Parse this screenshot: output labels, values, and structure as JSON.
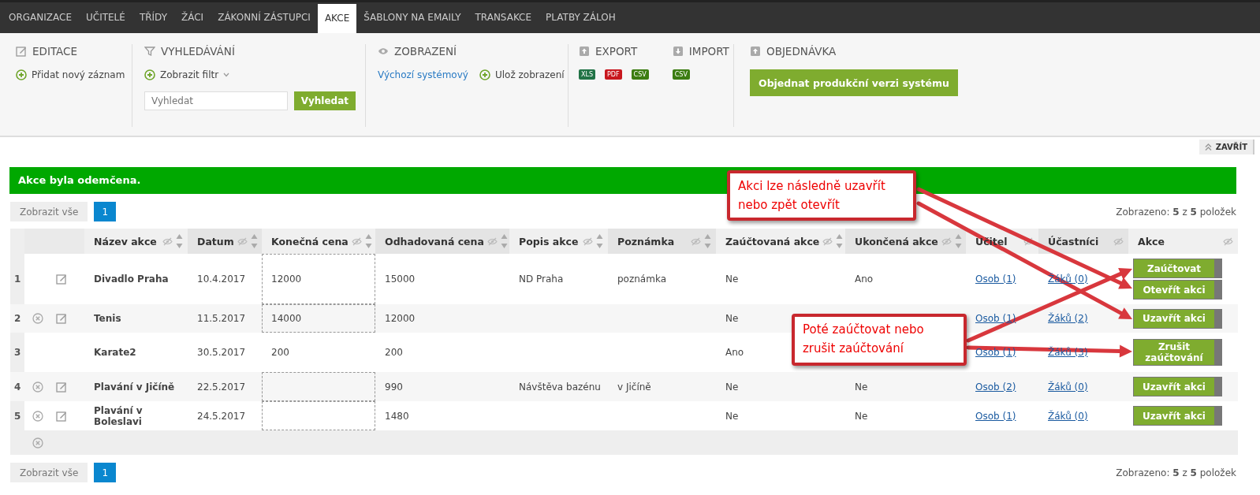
{
  "nav": {
    "tabs": [
      {
        "label": "ORGANIZACE",
        "selected": false
      },
      {
        "label": "UČITELÉ",
        "selected": false
      },
      {
        "label": "TŘÍDY",
        "selected": false
      },
      {
        "label": "ŽÁCI",
        "selected": false
      },
      {
        "label": "ZÁKONNÍ ZÁSTUPCI",
        "selected": false
      },
      {
        "label": "AKCE",
        "selected": true
      },
      {
        "label": "ŠABLONY NA EMAILY",
        "selected": false
      },
      {
        "label": "TRANSAKCE",
        "selected": false
      },
      {
        "label": "PLATBY ZÁLOH",
        "selected": false
      }
    ]
  },
  "toolbar": {
    "editing": {
      "title": "EDITACE",
      "add_label": "Přidat nový záznam"
    },
    "search": {
      "title": "VYHLEDÁVÁNÍ",
      "filter_label": "Zobrazit filtr",
      "placeholder": "Vyhledat",
      "button": "Vyhledat"
    },
    "view": {
      "title": "ZOBRAZENÍ",
      "default_link": "Výchozí systémový",
      "save_label": "Ulož zobrazení"
    },
    "export": {
      "title": "EXPORT",
      "formats": [
        {
          "label": "XLS",
          "color": "#217346"
        },
        {
          "label": "PDF",
          "color": "#c8171e"
        },
        {
          "label": "CSV",
          "color": "#3c7d12"
        }
      ]
    },
    "import": {
      "title": "IMPORT",
      "formats": [
        {
          "label": "CSV",
          "color": "#3c7d12"
        }
      ]
    },
    "order": {
      "title": "OBJEDNÁVKA",
      "button": "Objednat produkční verzi systému"
    },
    "close_label": "ZAVŘÍT"
  },
  "alert": {
    "text": "Akce byla odemčena."
  },
  "pager_top": {
    "show_all": "Zobrazit vše",
    "pages": [
      {
        "label": "1",
        "selected": true
      }
    ],
    "summary": "Zobrazeno: **5** z **5** položek"
  },
  "table": {
    "columns": [
      {
        "label": "Název akce",
        "sortable": true
      },
      {
        "label": "Datum",
        "sortable": true
      },
      {
        "label": "Konečná cena",
        "sortable": true
      },
      {
        "label": "Odhadovaná cena",
        "sortable": true
      },
      {
        "label": "Popis akce",
        "sortable": true
      },
      {
        "label": "Poznámka",
        "sortable": true
      },
      {
        "label": "Zaúčtovaná akce",
        "sortable": true
      },
      {
        "label": "Ukončená akce",
        "sortable": true
      },
      {
        "label": "Učitel",
        "sortable": false
      },
      {
        "label": "Účastníci",
        "sortable": false
      },
      {
        "label": "Akce",
        "sortable": false
      }
    ],
    "rows": [
      {
        "number": "1",
        "deletable": false,
        "editable": true,
        "price_editable": true,
        "cells": [
          "Divadlo Praha",
          "10.4.2017",
          "12000",
          "15000",
          "ND Praha",
          "poznámka",
          "Ne",
          "Ano"
        ],
        "teacher": "Osob (1)",
        "participants": "Žáků (0)",
        "actions": [
          "Zaúčtovat",
          "Otevřít akci"
        ]
      },
      {
        "number": "2",
        "deletable": true,
        "editable": true,
        "price_editable": true,
        "cells": [
          "Tenis",
          "11.5.2017",
          "14000",
          "12000",
          "",
          "",
          "Ne",
          ""
        ],
        "teacher": "Osob (1)",
        "participants": "Žáků (2)",
        "actions": [
          "Uzavřít akci"
        ]
      },
      {
        "number": "3",
        "deletable": false,
        "editable": false,
        "price_editable": false,
        "cells": [
          "Karate2",
          "30.5.2017",
          "200",
          "200",
          "",
          "",
          "Ano",
          ""
        ],
        "teacher": "Osob (1)",
        "participants": "Žáků (3)",
        "actions": [
          "Zrušit zaúčtování"
        ]
      },
      {
        "number": "4",
        "deletable": true,
        "editable": true,
        "price_editable": true,
        "cells": [
          "Plavání v Jičíně",
          "22.5.2017",
          "",
          "990",
          "Návštěva bazénu",
          "v Jičíně",
          "Ne",
          "Ne"
        ],
        "teacher": "Osob (2)",
        "participants": "Žáků (0)",
        "actions": [
          "Uzavřít akci"
        ]
      },
      {
        "number": "5",
        "deletable": true,
        "editable": true,
        "price_editable": true,
        "cells": [
          "Plavání v Boleslavi",
          "24.5.2017",
          "",
          "1480",
          "",
          "",
          "Ne",
          "Ne"
        ],
        "teacher": "Osob (1)",
        "participants": "Žáků (0)",
        "actions": [
          "Uzavřít akci"
        ]
      }
    ]
  },
  "pager_bottom": {
    "show_all": "Zobrazit vše",
    "pages": [
      {
        "label": "1",
        "selected": true
      }
    ],
    "summary": "Zobrazeno: **5** z **5** položek"
  },
  "callouts": [
    {
      "text": "Akci lze následně uzavřít nebo zpět otevřít"
    },
    {
      "text": "Poté zaúčtovat nebo zrušit zaúčtování"
    }
  ]
}
